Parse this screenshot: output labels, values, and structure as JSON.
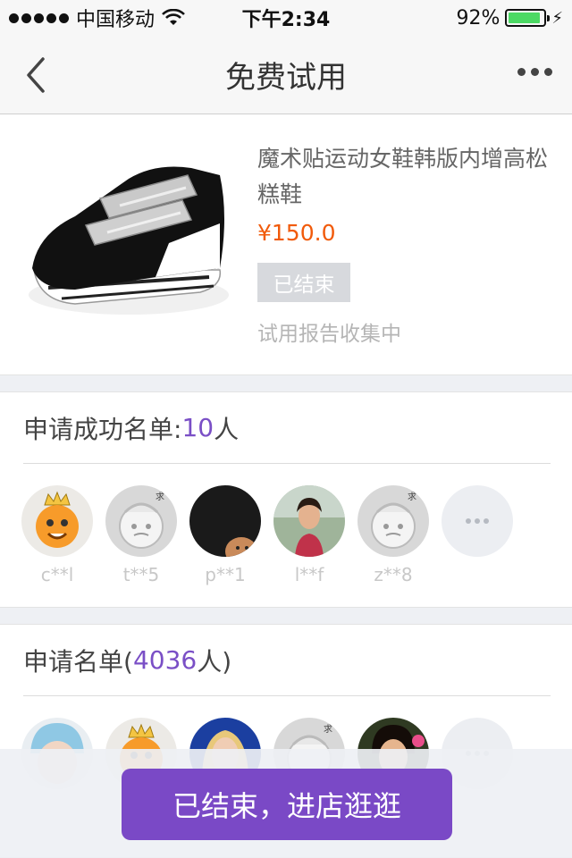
{
  "status_bar": {
    "carrier": "中国移动",
    "time": "下午2:34",
    "battery": "92%",
    "battery_level": 0.92
  },
  "nav": {
    "title": "免费试用",
    "back_icon": "chevron-left-icon",
    "more_icon": "more-horizontal-icon"
  },
  "product": {
    "title": "魔术贴运动女鞋韩版内增高松糕鞋",
    "price": "¥150.0",
    "status_badge": "已结束",
    "report_status": "试用报告收集中"
  },
  "success_list": {
    "title_prefix": "申请成功名单:",
    "count": "10",
    "title_suffix": "人",
    "users": [
      {
        "name": "c**l",
        "avatar": "cartoon-crown-avatar"
      },
      {
        "name": "t**5",
        "avatar": "placeholder-avatar"
      },
      {
        "name": "p**1",
        "avatar": "dark-photo-avatar"
      },
      {
        "name": "l**f",
        "avatar": "girl-photo-avatar"
      },
      {
        "name": "z**8",
        "avatar": "placeholder-avatar"
      }
    ]
  },
  "applicant_list": {
    "title_prefix": "申请名单(",
    "count": "4036",
    "title_suffix": "人)",
    "users": [
      {
        "avatar": "baby-photo-avatar"
      },
      {
        "avatar": "cartoon-crown-avatar"
      },
      {
        "avatar": "woman-photo-avatar"
      },
      {
        "avatar": "placeholder-avatar"
      },
      {
        "avatar": "girl-photo-avatar"
      }
    ]
  },
  "cta": {
    "label": "已结束，进店逛逛"
  },
  "colors": {
    "accent": "#7a49c6",
    "price": "#f15a0a",
    "count": "#7a4fc6"
  }
}
